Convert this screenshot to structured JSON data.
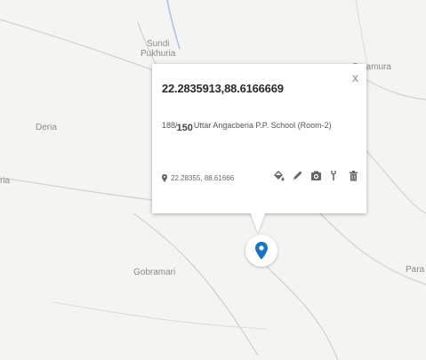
{
  "map": {
    "places": [
      {
        "name": "Sundi\nPukhuria"
      },
      {
        "name": "Saramura"
      },
      {
        "name": "Deria"
      },
      {
        "name": "ria"
      },
      {
        "name": "Gobramari"
      },
      {
        "name": "Para"
      }
    ]
  },
  "popup": {
    "title": "22.2835913,88.6166669",
    "close_label": "x",
    "address_prefix": "188/",
    "address_badge": "150",
    "address_text": "Uttar Angacberia P.P. School (Room-2)",
    "coords": "22.28355, 88.61666",
    "tools": [
      "paint-bucket-icon",
      "pencil-icon",
      "camera-icon",
      "wrench-icon",
      "trash-icon"
    ]
  },
  "colors": {
    "marker": "#1a73c4",
    "road": "#cfcfcf",
    "water": "#a9c4e6"
  }
}
